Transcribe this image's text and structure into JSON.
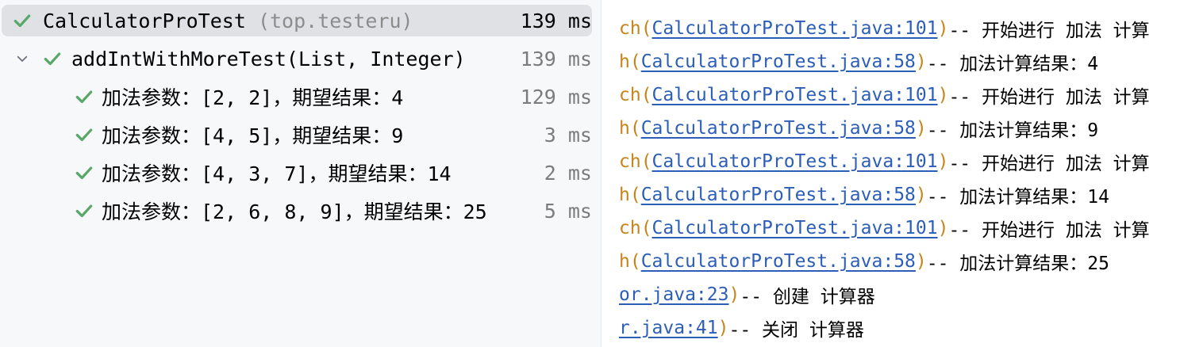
{
  "tree": {
    "root": {
      "name": "CalculatorProTest",
      "package": "(top.testeru)",
      "duration": "139 ms"
    },
    "method": {
      "name": "addIntWithMoreTest(List, Integer)",
      "duration": "139 ms"
    },
    "cases": [
      {
        "label": "加法参数：[2, 2]，期望结果：4",
        "duration": "129 ms"
      },
      {
        "label": "加法参数：[4, 5]，期望结果：9",
        "duration": "3 ms"
      },
      {
        "label": "加法参数：[4, 3, 7]，期望结果：14",
        "duration": "2 ms"
      },
      {
        "label": "加法参数：[2, 6, 8, 9]，期望结果：25",
        "duration": "5 ms"
      }
    ]
  },
  "console": {
    "lines": [
      {
        "prefix": "ch(",
        "link": "CalculatorProTest.java:101",
        "close": ")",
        "message": " -- 开始进行 加法 计算"
      },
      {
        "prefix": "h(",
        "link": "CalculatorProTest.java:58",
        "close": ")",
        "message": " -- 加法计算结果：4"
      },
      {
        "prefix": "ch(",
        "link": "CalculatorProTest.java:101",
        "close": ")",
        "message": " -- 开始进行 加法 计算"
      },
      {
        "prefix": "h(",
        "link": "CalculatorProTest.java:58",
        "close": ")",
        "message": " -- 加法计算结果：9"
      },
      {
        "prefix": "ch(",
        "link": "CalculatorProTest.java:101",
        "close": ")",
        "message": " -- 开始进行 加法 计算"
      },
      {
        "prefix": "h(",
        "link": "CalculatorProTest.java:58",
        "close": ")",
        "message": " -- 加法计算结果：14"
      },
      {
        "prefix": "ch(",
        "link": "CalculatorProTest.java:101",
        "close": ")",
        "message": " -- 开始进行 加法 计算"
      },
      {
        "prefix": "h(",
        "link": "CalculatorProTest.java:58",
        "close": ")",
        "message": " -- 加法计算结果：25"
      },
      {
        "prefix": "",
        "link": "or.java:23",
        "close": ")",
        "message": " -- 创建 计算器"
      },
      {
        "prefix": "",
        "link": "r.java:41",
        "close": ")",
        "message": " -- 关闭 计算器"
      }
    ]
  },
  "colors": {
    "pass_check": "#59a869",
    "link": "#2c5eb8",
    "paren": "#c6851b",
    "selected_row": "#dfe1e5"
  },
  "icons": {
    "pass": "check-icon",
    "expand": "chevron-down-icon"
  }
}
